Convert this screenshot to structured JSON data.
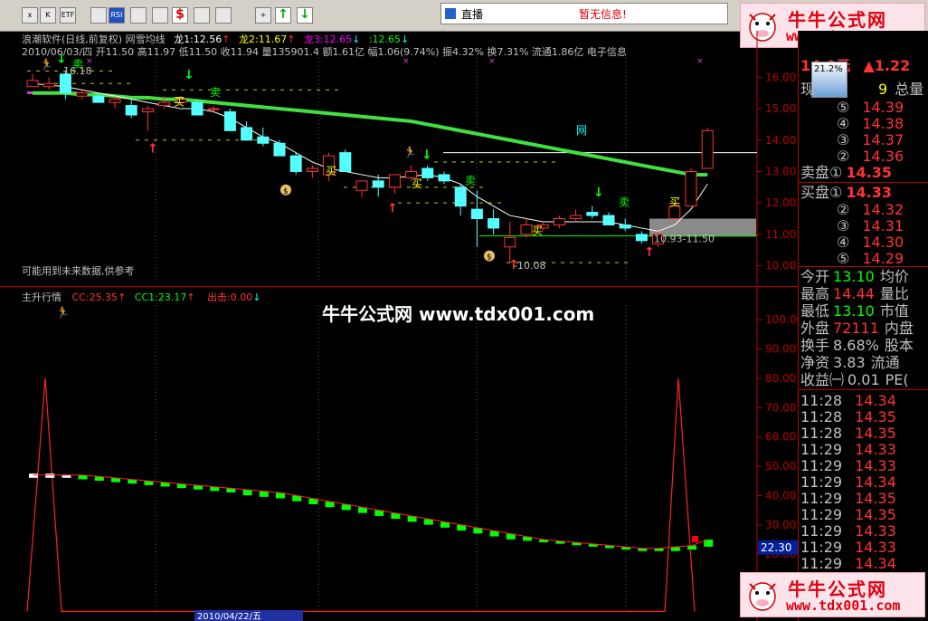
{
  "toolbar": {
    "buttons": [
      "x",
      "K",
      "ETF",
      "",
      "RSI",
      "",
      "",
      "$",
      "",
      "",
      "+",
      "↑",
      "↓"
    ],
    "live_label": "直播",
    "live_msg": "暂无信息!"
  },
  "logo": {
    "name": "牛牛公式网",
    "url": "www.tdx001.com"
  },
  "main_chart": {
    "title": "浪潮软件(日线,前复权) 网雪均线",
    "dragon1": "龙1:12.56",
    "dragon2": "龙2:11.67",
    "dragon3": "龙3:12.65",
    "dragon4": ":12.65",
    "quote_line": "2010/06/03/四 开11.50 高11.97 低11.50 收11.94 量135901.4 额1.61亿 幅1.06(9.74%) 振4.32% 换7.31% 流通1.86亿 电子信息",
    "note": "可能用到未来数据,供参考",
    "label_high": "16.18",
    "label_low": "10.08",
    "label_range": "10.93-11.50",
    "label_net": "网",
    "buy": "买",
    "sell": "卖",
    "axis": [
      "16.00",
      "15.00",
      "14.00",
      "13.00",
      "12.00",
      "11.00",
      "10.00"
    ]
  },
  "chart_data": {
    "type": "candlestick",
    "y_axis": {
      "min": 9.7,
      "max": 16.5
    },
    "candles": [
      {
        "o": 15.9,
        "h": 16.1,
        "l": 15.7,
        "c": 15.7,
        "up": true
      },
      {
        "o": 15.8,
        "h": 16.0,
        "l": 15.6,
        "c": 15.7,
        "up": true
      },
      {
        "o": 16.1,
        "h": 16.2,
        "l": 15.3,
        "c": 15.5,
        "up": false
      },
      {
        "o": 15.5,
        "h": 15.6,
        "l": 15.3,
        "c": 15.4,
        "up": true
      },
      {
        "o": 15.4,
        "h": 15.5,
        "l": 15.3,
        "c": 15.2,
        "up": false
      },
      {
        "o": 15.2,
        "h": 15.4,
        "l": 15.0,
        "c": 15.3,
        "up": true
      },
      {
        "o": 15.1,
        "h": 15.3,
        "l": 14.7,
        "c": 14.8,
        "up": false
      },
      {
        "o": 14.9,
        "h": 15.1,
        "l": 14.3,
        "c": 15.0,
        "up": true
      },
      {
        "o": 15.2,
        "h": 15.4,
        "l": 15.0,
        "c": 15.1,
        "up": true
      },
      {
        "o": 15.3,
        "h": 15.4,
        "l": 15.1,
        "c": 15.2,
        "up": true
      },
      {
        "o": 15.2,
        "h": 15.3,
        "l": 14.8,
        "c": 14.8,
        "up": false
      },
      {
        "o": 15.0,
        "h": 15.1,
        "l": 14.9,
        "c": 15.0,
        "up": true
      },
      {
        "o": 14.9,
        "h": 15.0,
        "l": 14.3,
        "c": 14.3,
        "up": false
      },
      {
        "o": 14.4,
        "h": 14.6,
        "l": 14.0,
        "c": 14.0,
        "up": false
      },
      {
        "o": 14.1,
        "h": 14.4,
        "l": 13.8,
        "c": 13.9,
        "up": false
      },
      {
        "o": 13.9,
        "h": 14.0,
        "l": 13.5,
        "c": 13.5,
        "up": false
      },
      {
        "o": 13.5,
        "h": 13.6,
        "l": 12.9,
        "c": 13.0,
        "up": false
      },
      {
        "o": 13.0,
        "h": 13.2,
        "l": 12.8,
        "c": 13.1,
        "up": true
      },
      {
        "o": 12.9,
        "h": 13.6,
        "l": 12.7,
        "c": 13.5,
        "up": true
      },
      {
        "o": 13.6,
        "h": 13.7,
        "l": 13.0,
        "c": 13.0,
        "up": false
      },
      {
        "o": 12.4,
        "h": 12.7,
        "l": 12.2,
        "c": 12.7,
        "up": true
      },
      {
        "o": 12.7,
        "h": 12.9,
        "l": 12.2,
        "c": 12.5,
        "up": false
      },
      {
        "o": 12.5,
        "h": 12.9,
        "l": 12.3,
        "c": 12.9,
        "up": true
      },
      {
        "o": 12.8,
        "h": 13.2,
        "l": 12.7,
        "c": 13.0,
        "up": true
      },
      {
        "o": 13.1,
        "h": 13.2,
        "l": 12.7,
        "c": 12.8,
        "up": false
      },
      {
        "o": 12.9,
        "h": 13.0,
        "l": 12.6,
        "c": 12.7,
        "up": false
      },
      {
        "o": 12.5,
        "h": 12.6,
        "l": 11.6,
        "c": 11.9,
        "up": false
      },
      {
        "o": 11.8,
        "h": 12.4,
        "l": 10.6,
        "c": 11.5,
        "up": false
      },
      {
        "o": 11.5,
        "h": 11.8,
        "l": 11.0,
        "c": 11.2,
        "up": false
      },
      {
        "o": 10.9,
        "h": 11.4,
        "l": 10.1,
        "c": 10.6,
        "up": true
      },
      {
        "o": 11.0,
        "h": 11.5,
        "l": 10.9,
        "c": 11.3,
        "up": true
      },
      {
        "o": 11.2,
        "h": 11.4,
        "l": 11.1,
        "c": 11.3,
        "up": true
      },
      {
        "o": 11.3,
        "h": 11.6,
        "l": 11.2,
        "c": 11.5,
        "up": true
      },
      {
        "o": 11.5,
        "h": 11.8,
        "l": 11.4,
        "c": 11.6,
        "up": true
      },
      {
        "o": 11.7,
        "h": 11.9,
        "l": 11.5,
        "c": 11.6,
        "up": false
      },
      {
        "o": 11.6,
        "h": 11.7,
        "l": 11.3,
        "c": 11.3,
        "up": false
      },
      {
        "o": 11.3,
        "h": 11.5,
        "l": 11.1,
        "c": 11.2,
        "up": false
      },
      {
        "o": 11.0,
        "h": 11.1,
        "l": 10.7,
        "c": 10.8,
        "up": false
      },
      {
        "o": 10.7,
        "h": 11.1,
        "l": 10.6,
        "c": 11.0,
        "up": true
      },
      {
        "o": 11.5,
        "h": 12.0,
        "l": 11.5,
        "c": 11.9,
        "up": true
      },
      {
        "o": 11.9,
        "h": 13.1,
        "l": 11.9,
        "c": 13.0,
        "up": true
      },
      {
        "o": 13.1,
        "h": 14.4,
        "l": 13.1,
        "c": 14.3,
        "up": true
      }
    ],
    "ma_green": [
      15.5,
      15.5,
      15.5,
      15.45,
      15.45,
      15.4,
      15.35,
      15.35,
      15.3,
      15.3,
      15.25,
      15.2,
      15.15,
      15.1,
      15.05,
      15.0,
      14.95,
      14.9,
      14.85,
      14.8,
      14.75,
      14.7,
      14.65,
      14.6,
      14.5,
      14.4,
      14.3,
      14.2,
      14.1,
      14.0,
      13.9,
      13.8,
      13.7,
      13.6,
      13.5,
      13.4,
      13.3,
      13.2,
      13.1,
      13.0,
      12.9,
      12.9
    ],
    "ma_white": [
      15.8,
      15.75,
      15.7,
      15.6,
      15.5,
      15.4,
      15.3,
      15.2,
      15.1,
      15.0,
      15.0,
      14.9,
      14.7,
      14.4,
      14.1,
      13.9,
      13.6,
      13.3,
      13.1,
      13.0,
      12.9,
      12.8,
      12.8,
      12.85,
      12.9,
      12.8,
      12.6,
      12.2,
      11.9,
      11.6,
      11.5,
      11.4,
      11.4,
      11.4,
      11.4,
      11.4,
      11.3,
      11.2,
      11.1,
      11.3,
      11.8,
      12.6
    ]
  },
  "sub_chart": {
    "title": "主升行情",
    "cc": "CC:25.35",
    "cc1": "CC1:23.17",
    "out": "出击:0.00",
    "axis": [
      "100.00",
      "90.00",
      "80.00",
      "70.00",
      "60.00",
      "50.00",
      "40.00",
      "30.00",
      "20.00"
    ],
    "current_value": "22.30",
    "cc_series": [
      47,
      47,
      47,
      47,
      46.5,
      46,
      45.5,
      45,
      44.5,
      44,
      43.5,
      43,
      42.5,
      42,
      41.5,
      41,
      40,
      39,
      38,
      37,
      36,
      35,
      34,
      33,
      32,
      31,
      30,
      29,
      28,
      27,
      26,
      25,
      24.5,
      24,
      23.5,
      23,
      22.5,
      22,
      22,
      22.5,
      23,
      25
    ],
    "cc1_series": [
      47.5,
      47.5,
      47,
      46.5,
      46,
      45.5,
      45,
      44.5,
      44,
      43.5,
      43,
      42.5,
      42,
      41,
      40.5,
      40,
      39,
      38,
      37,
      36,
      35,
      34,
      33,
      32,
      31,
      30,
      29,
      28,
      27,
      26,
      25.5,
      25,
      24.5,
      24,
      23.5,
      23,
      22.5,
      22,
      22,
      22,
      22.5,
      23.5
    ]
  },
  "panel": {
    "price": "14.0元",
    "change": "▲1.22",
    "pct": "21.2%",
    "now_label": "现",
    "now_vol": "9",
    "total_label": "总量",
    "asks": [
      {
        "k": "⑤",
        "v": "14.39"
      },
      {
        "k": "④",
        "v": "14.38"
      },
      {
        "k": "③",
        "v": "14.37"
      },
      {
        "k": "②",
        "v": "14.36"
      }
    ],
    "ask1_label": "卖盘①",
    "ask1": "14.35",
    "bid1_label": "买盘①",
    "bid1": "14.33",
    "bids": [
      {
        "k": "②",
        "v": "14.32"
      },
      {
        "k": "③",
        "v": "14.31"
      },
      {
        "k": "④",
        "v": "14.30"
      },
      {
        "k": "⑤",
        "v": "14.29"
      }
    ],
    "stats": [
      {
        "k": "今开",
        "v": "13.10",
        "k2": "均价",
        "c": "#0f0"
      },
      {
        "k": "最高",
        "v": "14.44",
        "k2": "量比",
        "c": "#f33"
      },
      {
        "k": "最低",
        "v": "13.10",
        "k2": "市值",
        "c": "#0f0"
      },
      {
        "k": "外盘",
        "v": "72111",
        "k2": "内盘",
        "c": "#f33"
      },
      {
        "k": "换手",
        "v": "8.68%",
        "k2": "股本",
        "c": "#c0c0c0"
      },
      {
        "k": "净资",
        "v": "3.83",
        "k2": "流通",
        "c": "#c0c0c0"
      },
      {
        "k": "收益㈠",
        "v": "0.01",
        "k2": "PE(",
        "c": "#c0c0c0"
      }
    ],
    "ticks": [
      {
        "t": "11:28",
        "v": "14.34"
      },
      {
        "t": "11:28",
        "v": "14.35"
      },
      {
        "t": "11:28",
        "v": "14.35"
      },
      {
        "t": "11:29",
        "v": "14.33"
      },
      {
        "t": "11:29",
        "v": "14.33"
      },
      {
        "t": "11:29",
        "v": "14.34"
      },
      {
        "t": "11:29",
        "v": "14.35"
      },
      {
        "t": "11:29",
        "v": "14.35"
      },
      {
        "t": "11:29",
        "v": "14.33"
      },
      {
        "t": "11:29",
        "v": "14.33"
      },
      {
        "t": "11:29",
        "v": "14.34"
      }
    ]
  },
  "watermark": "牛牛公式网 www.tdx001.com",
  "bottom_date": "2010/04/22/五"
}
